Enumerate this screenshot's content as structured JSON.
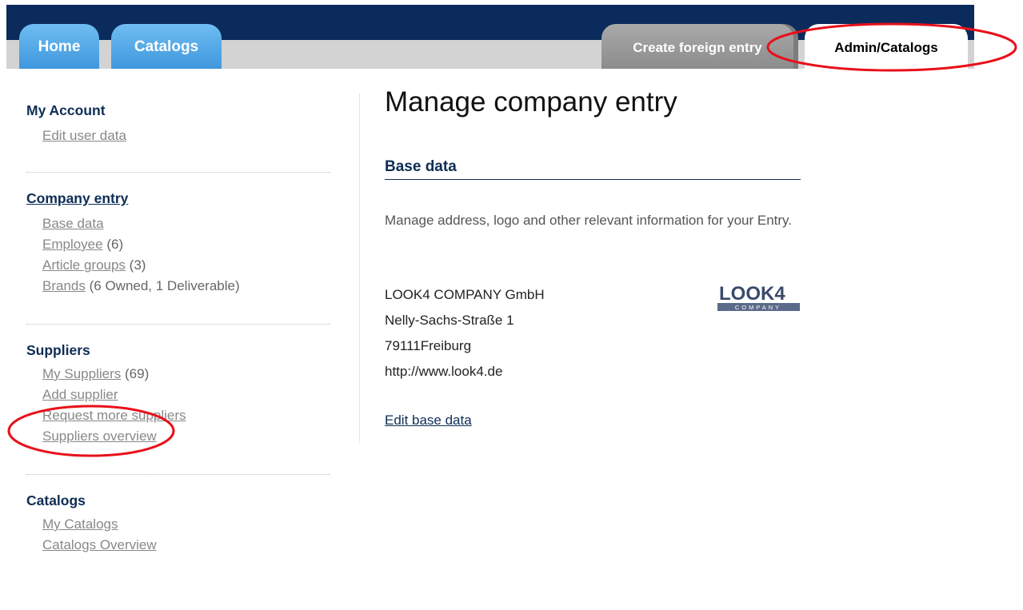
{
  "nav": {
    "tabs": [
      "Home",
      "Catalogs"
    ],
    "right_tabs": [
      "Create foreign entry",
      "Admin/Catalogs"
    ]
  },
  "sidebar": {
    "my_account": {
      "title": "My Account",
      "items": [
        "Edit user data"
      ]
    },
    "company_entry": {
      "title": "Company entry",
      "items": [
        {
          "label": "Base data",
          "count": ""
        },
        {
          "label": "Employee",
          "count": "(6)"
        },
        {
          "label": "Article groups",
          "count": "(3)"
        },
        {
          "label": "Brands",
          "count": "(6 Owned, 1 Deliverable)"
        }
      ]
    },
    "suppliers": {
      "title": "Suppliers",
      "items": [
        {
          "label": "My Suppliers",
          "count": "(69)"
        },
        {
          "label": "Add supplier",
          "count": ""
        },
        {
          "label": "Request more suppliers",
          "count": ""
        },
        {
          "label": "Suppliers overview",
          "count": ""
        }
      ]
    },
    "catalogs": {
      "title": "Catalogs",
      "items": [
        "My Catalogs",
        "Catalogs Overview"
      ]
    }
  },
  "main": {
    "title": "Manage company entry",
    "section_title": "Base data",
    "description": "Manage address, logo and other relevant information for your Entry.",
    "address": {
      "company": "LOOK4 COMPANY GmbH",
      "street": "Nelly-Sachs-Straße 1",
      "city": "79111Freiburg",
      "url": "http://www.look4.de"
    },
    "edit_link": "Edit base data",
    "logo": {
      "text": "LOOK4",
      "subtext": "COMPANY"
    }
  },
  "colors": {
    "header_navy": "#0b2b5c",
    "tab_blue": "#4aa3e6",
    "heading_navy": "#0e2d55",
    "annotation_red": "#e8101a"
  }
}
